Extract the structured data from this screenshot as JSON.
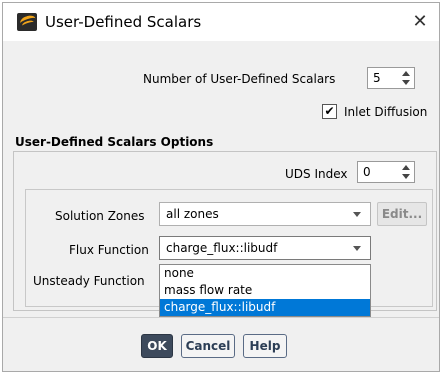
{
  "window": {
    "title": "User-Defined Scalars",
    "close_icon": "✕"
  },
  "num_scalars": {
    "label": "Number of User-Defined Scalars",
    "value": "5"
  },
  "inlet_diffusion": {
    "label": "Inlet Diffusion",
    "checked": true,
    "check_glyph": "✔"
  },
  "options": {
    "section_title": "User-Defined Scalars Options",
    "uds_index_label": "UDS Index",
    "uds_index_value": "0",
    "solution_zones_label": "Solution Zones",
    "solution_zones_value": "all zones",
    "edit_label": "Edit...",
    "flux_function_label": "Flux Function",
    "flux_function_value": "charge_flux::libudf",
    "unsteady_function_label": "Unsteady Function",
    "flux_options": [
      "none",
      "mass flow rate",
      "charge_flux::libudf"
    ]
  },
  "footer": {
    "ok_label": "OK",
    "cancel_label": "Cancel",
    "help_label": "Help"
  },
  "colors": {
    "selection": "#0078d7",
    "primary_button": "#3d4a5c",
    "secondary_button_border": "#5a6b85",
    "brand_icon_accent": "#f2a51a"
  }
}
